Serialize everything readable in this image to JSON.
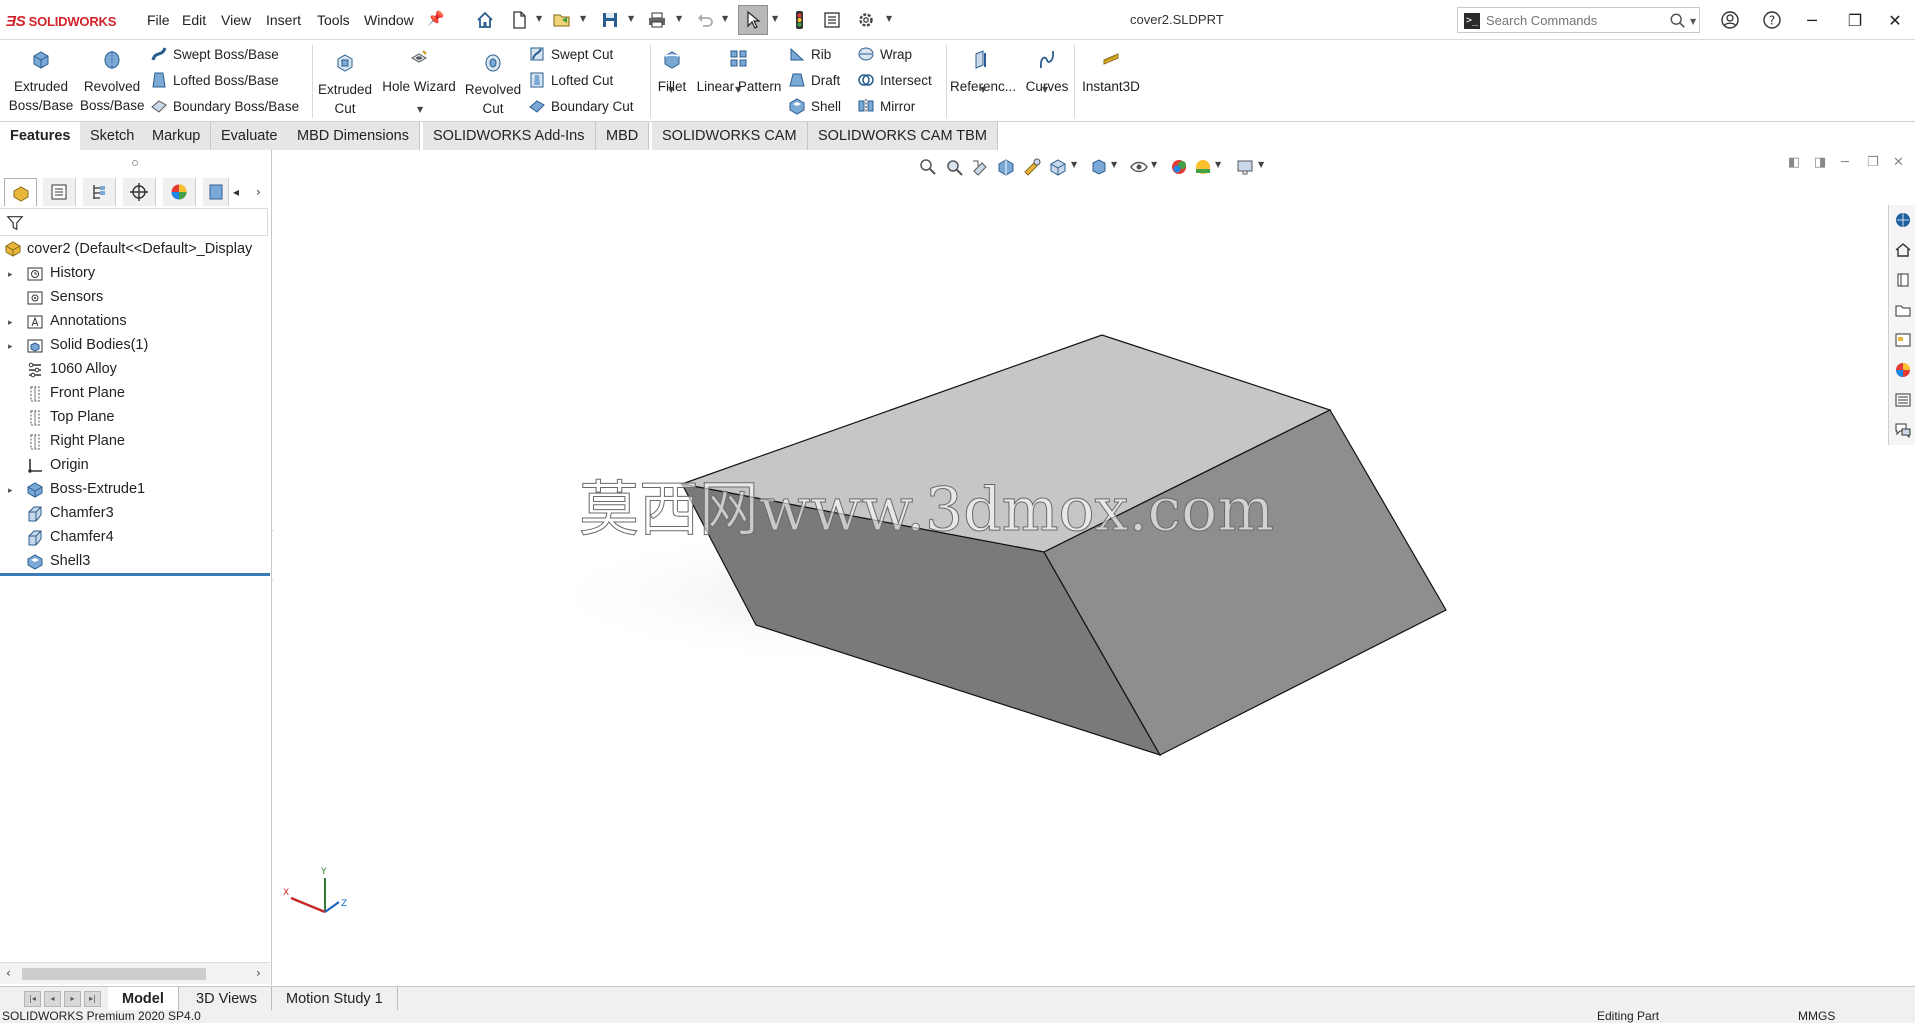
{
  "app": {
    "brand": "SOLIDWORKS",
    "document_title": "cover2.SLDPRT",
    "menu": [
      "File",
      "Edit",
      "View",
      "Insert",
      "Tools",
      "Window"
    ],
    "search": {
      "placeholder": "Search Commands"
    }
  },
  "command_manager": {
    "extruded_boss": "Extruded Boss/Base",
    "revolved_boss": "Revolved Boss/Base",
    "swept_boss": "Swept Boss/Base",
    "lofted_boss": "Lofted Boss/Base",
    "boundary_boss": "Boundary Boss/Base",
    "extruded_cut": "Extruded Cut",
    "hole_wizard": "Hole Wizard",
    "revolved_cut": "Revolved Cut",
    "swept_cut": "Swept Cut",
    "lofted_cut": "Lofted Cut",
    "boundary_cut": "Boundary Cut",
    "fillet": "Fillet",
    "linear_pattern": "Linear Pattern",
    "rib": "Rib",
    "draft": "Draft",
    "shell": "Shell",
    "wrap": "Wrap",
    "intersect": "Intersect",
    "mirror": "Mirror",
    "reference": "Referenc...",
    "curves": "Curves",
    "instant3d": "Instant3D"
  },
  "tabs": [
    "Features",
    "Sketch",
    "Markup",
    "Evaluate",
    "MBD Dimensions",
    "SOLIDWORKS Add-Ins",
    "MBD",
    "SOLIDWORKS CAM",
    "SOLIDWORKS CAM TBM"
  ],
  "feature_tree": {
    "root": "cover2  (Default<<Default>_Display",
    "nodes": [
      {
        "label": "History",
        "expandable": true,
        "icon": "history-icon"
      },
      {
        "label": "Sensors",
        "expandable": false,
        "icon": "sensors-icon"
      },
      {
        "label": "Annotations",
        "expandable": true,
        "icon": "annotations-icon"
      },
      {
        "label": "Solid Bodies(1)",
        "expandable": true,
        "icon": "solid-bodies-icon"
      },
      {
        "label": "1060 Alloy",
        "expandable": false,
        "icon": "material-icon"
      },
      {
        "label": "Front Plane",
        "expandable": false,
        "icon": "plane-icon"
      },
      {
        "label": "Top Plane",
        "expandable": false,
        "icon": "plane-icon"
      },
      {
        "label": "Right Plane",
        "expandable": false,
        "icon": "plane-icon"
      },
      {
        "label": "Origin",
        "expandable": false,
        "icon": "origin-icon"
      },
      {
        "label": "Boss-Extrude1",
        "expandable": true,
        "icon": "extrude-icon"
      },
      {
        "label": "Chamfer3",
        "expandable": false,
        "icon": "chamfer-icon"
      },
      {
        "label": "Chamfer4",
        "expandable": false,
        "icon": "chamfer-icon"
      },
      {
        "label": "Shell3",
        "expandable": false,
        "icon": "shell-icon"
      }
    ]
  },
  "viewport": {
    "watermark": "莫西网www.3dmox.com",
    "triad": {
      "x": "X",
      "y": "Y",
      "z": "Z"
    }
  },
  "bottom_tabs": [
    "Model",
    "3D Views",
    "Motion Study 1"
  ],
  "status": {
    "version": "SOLIDWORKS Premium 2020 SP4.0",
    "mode": "Editing Part",
    "units": "MMGS"
  },
  "colors": {
    "brand_red": "#d2232a",
    "accent_blue": "#3b7cb4",
    "model_top": "#c6c6c6",
    "model_front": "#7a7a7a",
    "model_right": "#8e8e8e"
  }
}
